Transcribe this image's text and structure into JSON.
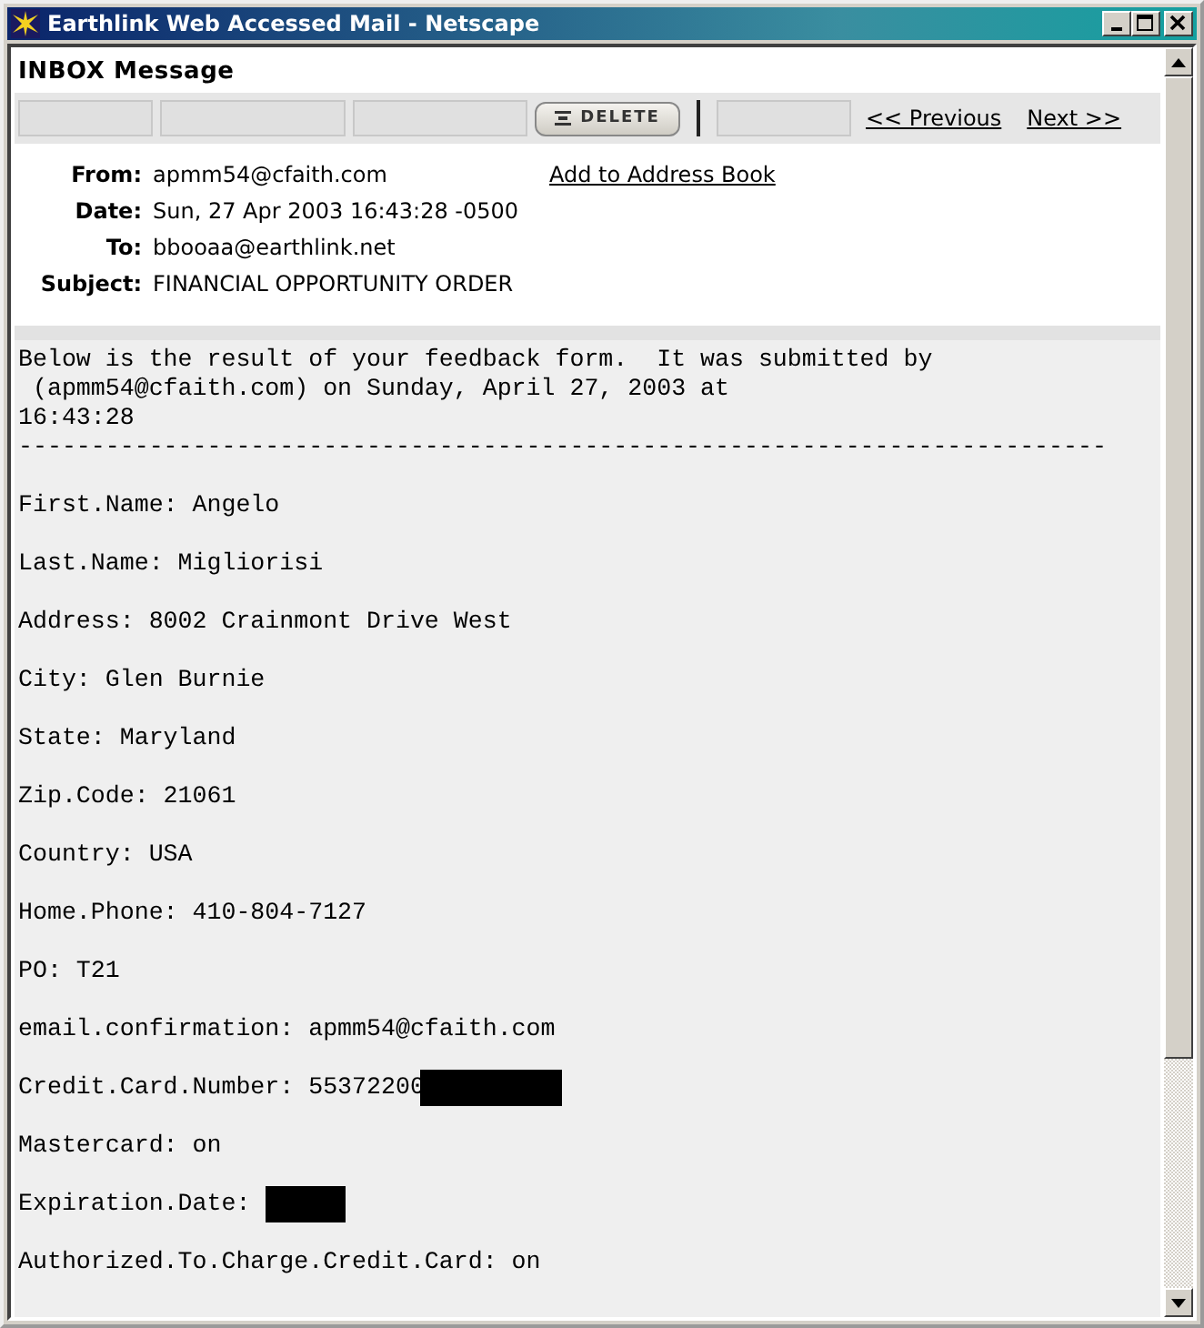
{
  "window": {
    "title": "Earthlink Web Accessed Mail - Netscape"
  },
  "page_title": "INBOX Message",
  "toolbar": {
    "delete_button": "DELETE",
    "previous_link": "<< Previous",
    "next_link": "Next >>"
  },
  "headers": [
    {
      "label": "From:",
      "value": "apmm54@cfaith.com",
      "link": "Add to Address Book"
    },
    {
      "label": "Date:",
      "value": "Sun, 27 Apr 2003 16:43:28 -0500"
    },
    {
      "label": "To:",
      "value": "bbooaa@earthlink.net"
    },
    {
      "label": "Subject:",
      "value": "FINANCIAL OPPORTUNITY ORDER"
    }
  ],
  "body": {
    "intro": [
      "Below is the result of your feedback form.  It was submitted by",
      " (apmm54@cfaith.com) on Sunday, April 27, 2003 at",
      "16:43:28"
    ],
    "divider": "---------------------------------------------------------------------------",
    "fields": [
      {
        "text": "First.Name: Angelo",
        "redacted": false
      },
      {
        "text": "Last.Name: Migliorisi",
        "redacted": false
      },
      {
        "text": "Address: 8002 Crainmont Drive West",
        "redacted": false
      },
      {
        "text": "City: Glen Burnie",
        "redacted": false
      },
      {
        "text": "State: Maryland",
        "redacted": false
      },
      {
        "text": "Zip.Code: 21061",
        "redacted": false
      },
      {
        "text": "Country: USA",
        "redacted": false
      },
      {
        "text": "Home.Phone: 410-804-7127",
        "redacted": false
      },
      {
        "text": "PO: T21",
        "redacted": false
      },
      {
        "text": "email.confirmation: apmm54@cfaith.com",
        "redacted": false
      },
      {
        "text": "Credit.Card.Number: 55372200",
        "redacted": true
      },
      {
        "text": "Mastercard: on",
        "redacted": false
      },
      {
        "text": "Expiration.Date:",
        "redacted": true
      },
      {
        "text": "Authorized.To.Charge.Credit.Card: on",
        "redacted": false
      }
    ]
  }
}
